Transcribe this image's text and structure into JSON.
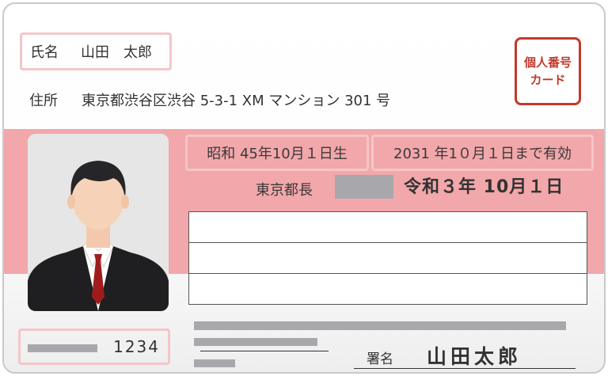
{
  "name": {
    "label": "氏名",
    "value": "山田　太郎"
  },
  "address": {
    "label": "住所",
    "value": "東京都渋谷区渋谷 5-3-1 XM マンション 301 号"
  },
  "stamp": {
    "line1": "個人番号",
    "line2": "カード",
    "color": "#c0392b"
  },
  "birth": {
    "text": "昭和 45年10月１日生"
  },
  "expiry": {
    "text": "2031 年1０月１日まで有効"
  },
  "issuer": {
    "label": "東京都長"
  },
  "issue_date": {
    "text": "令和３年 10月１日"
  },
  "card_number": {
    "text": "1234"
  },
  "signature": {
    "label": "署名",
    "value": "山田太郎"
  },
  "colors": {
    "band": "#f2a7aa",
    "box_border": "#f3c6c8",
    "redaction": "#a8a8ac",
    "stamp": "#c0392b"
  },
  "photo": {
    "icon": "portrait-man-in-suit"
  }
}
